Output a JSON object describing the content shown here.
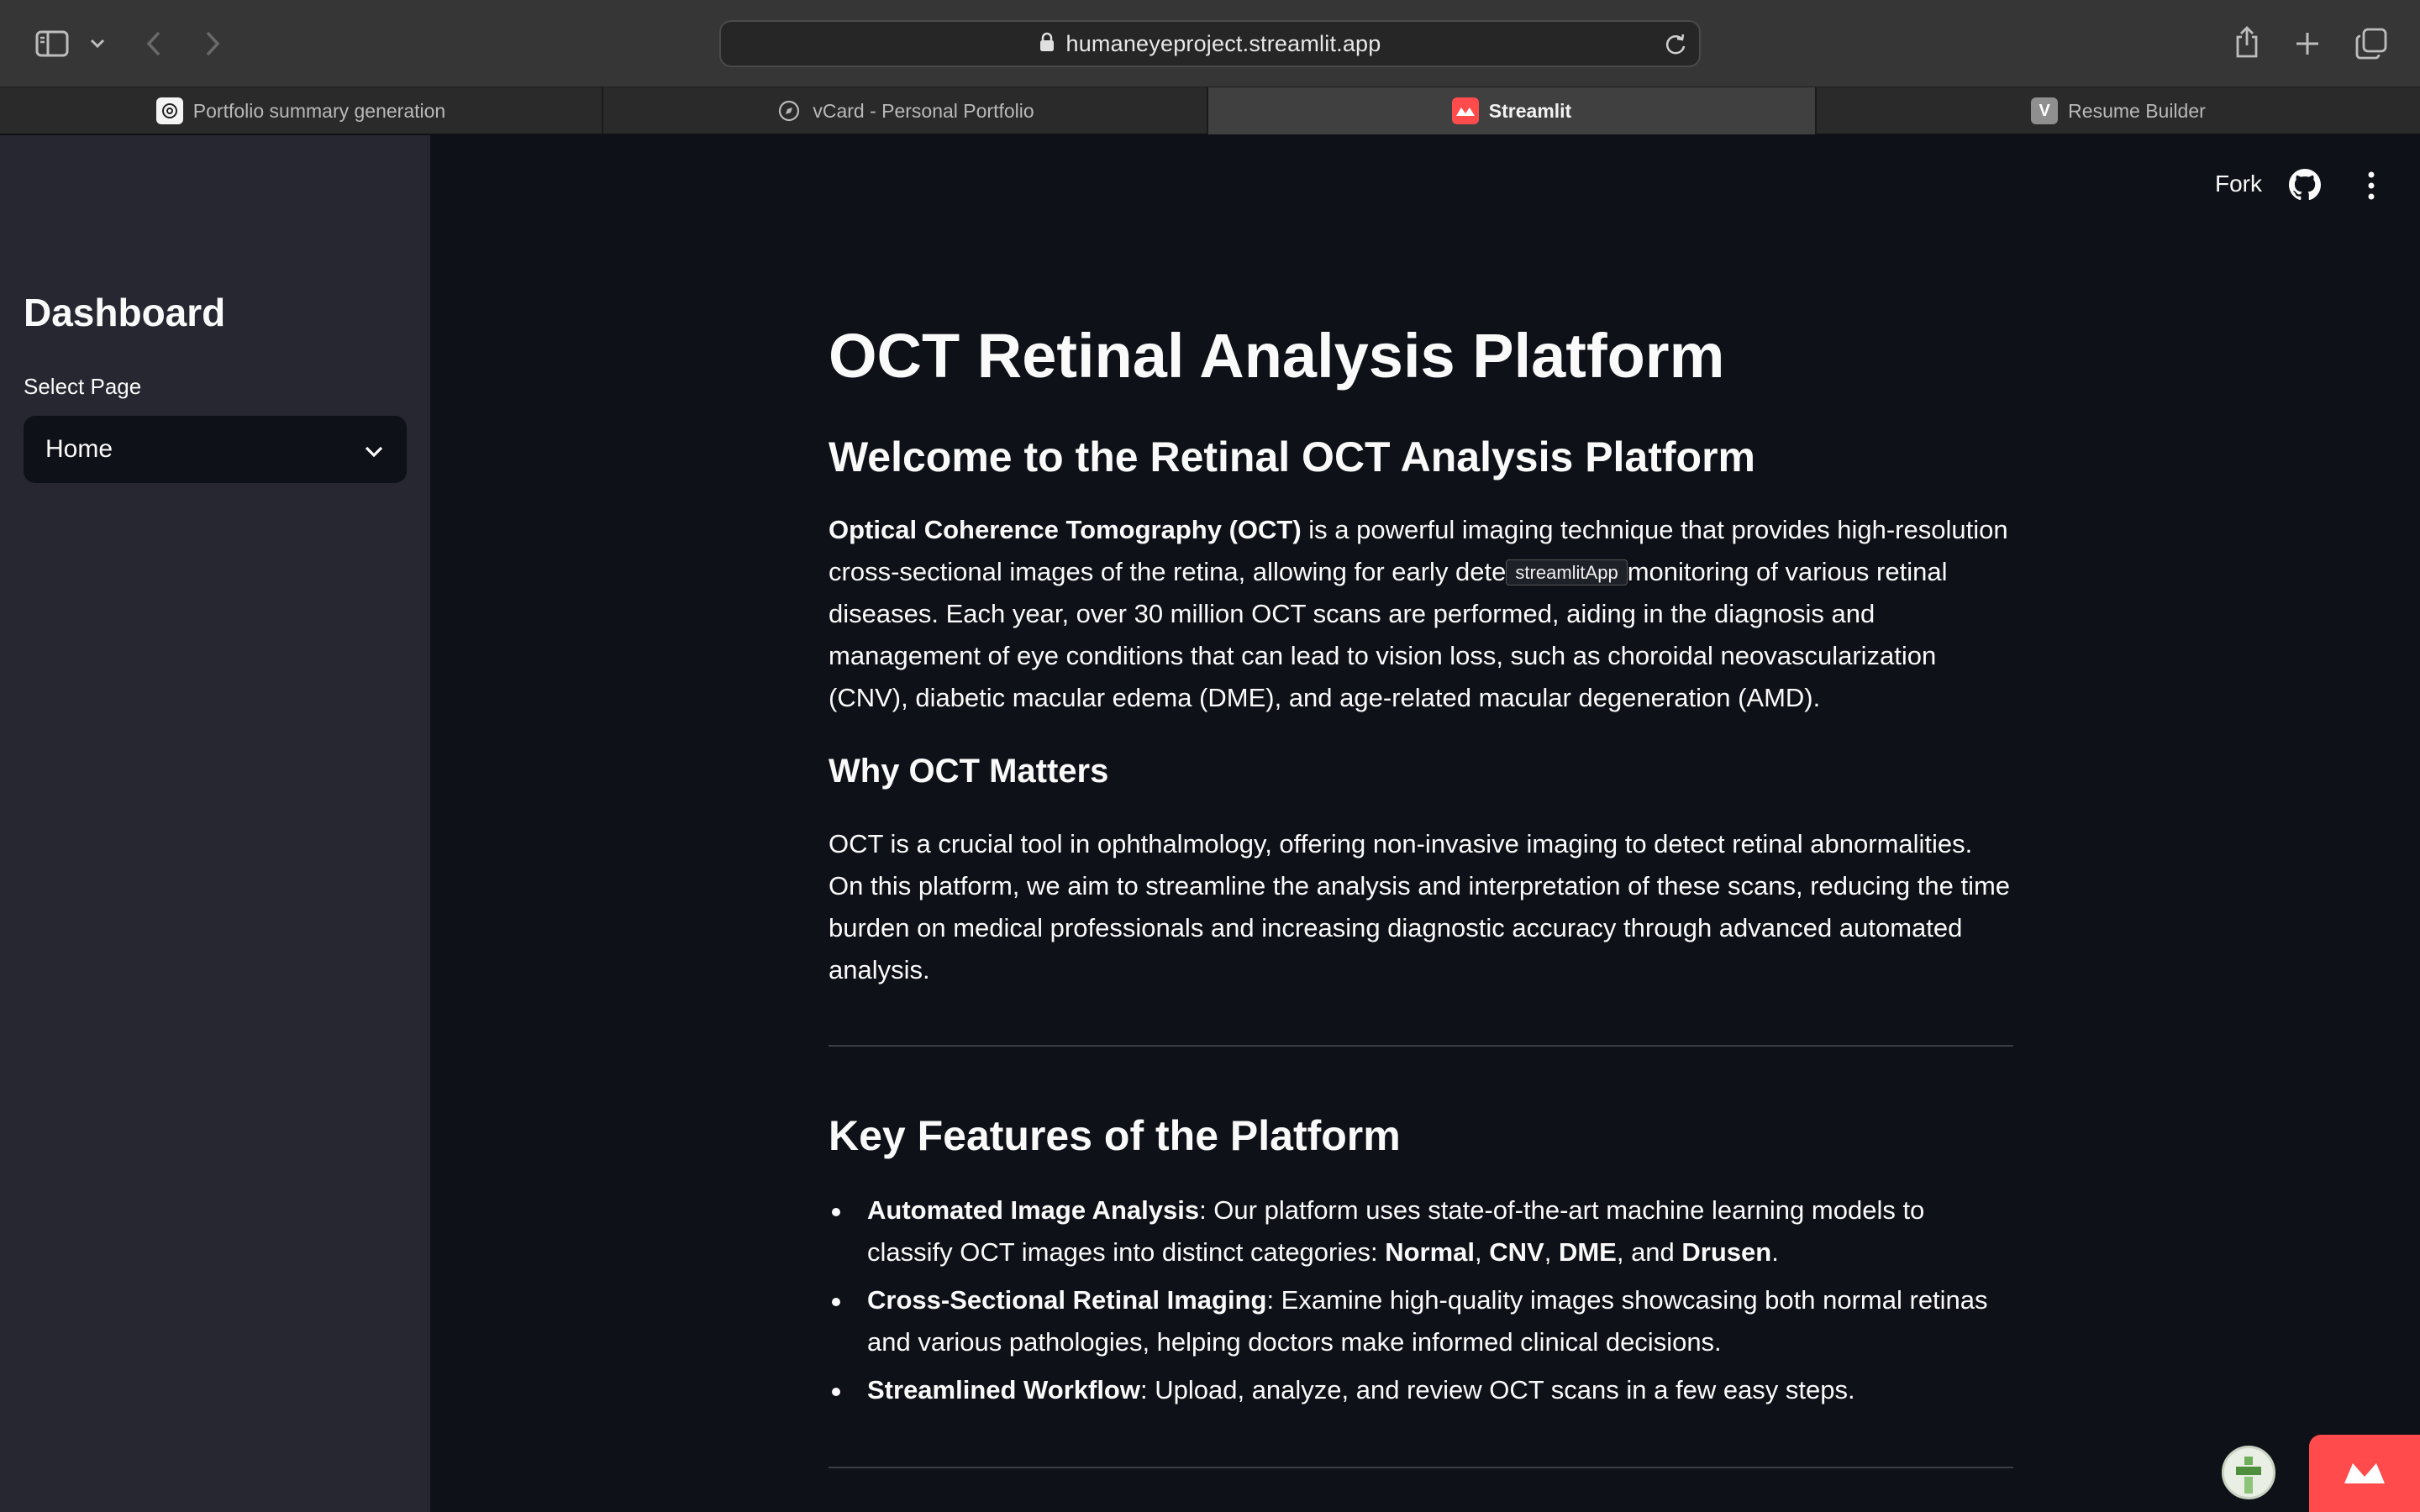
{
  "browser": {
    "url": "humaneyeproject.streamlit.app",
    "tabs": [
      {
        "label": "Portfolio summary generation",
        "icon": "openai-icon",
        "active": false
      },
      {
        "label": "vCard - Personal Portfolio",
        "icon": "compass-icon",
        "active": false
      },
      {
        "label": "Streamlit",
        "icon": "streamlit-icon",
        "active": true
      },
      {
        "label": "Resume Builder",
        "icon": "v-letter-icon",
        "active": false
      }
    ]
  },
  "sidebar": {
    "title": "Dashboard",
    "select_label": "Select Page",
    "select_value": "Home"
  },
  "header": {
    "fork_label": "Fork"
  },
  "main": {
    "title": "OCT Retinal Analysis Platform",
    "welcome_heading": "Welcome to the Retinal OCT Analysis Platform",
    "intro_bold": "Optical Coherence Tomography (OCT)",
    "intro_rest_1": " is a powerful imaging technique that provides high-resolution cross-sectional images of the retina, allowing for early dete",
    "tooltip": "streamlitApp",
    "intro_rest_2": "monitoring of various retinal diseases. Each year, over 30 million OCT scans are performed, aiding in the diagnosis and management of eye conditions that can lead to vision loss, such as choroidal neovascularization (CNV), diabetic macular edema (DME), and age-related macular degeneration (AMD).",
    "why_heading": "Why OCT Matters",
    "why_text": "OCT is a crucial tool in ophthalmology, offering non-invasive imaging to detect retinal abnormalities. On this platform, we aim to streamline the analysis and interpretation of these scans, reducing the time burden on medical professionals and increasing diagnostic accuracy through advanced automated analysis.",
    "features_heading": "Key Features of the Platform",
    "features": [
      {
        "title": "Automated Image Analysis",
        "text_before": ": Our platform uses state-of-the-art machine learning models to classify OCT images into distinct categories: ",
        "cat1": "Normal",
        "sep1": ", ",
        "cat2": "CNV",
        "sep2": ", ",
        "cat3": "DME",
        "sep3": ", and ",
        "cat4": "Drusen",
        "end": "."
      },
      {
        "title": "Cross-Sectional Retinal Imaging",
        "text": ": Examine high-quality images showcasing both normal retinas and various pathologies, helping doctors make informed clinical decisions."
      },
      {
        "title": "Streamlined Workflow",
        "text": ": Upload, analyze, and review OCT scans in a few easy steps."
      }
    ]
  },
  "colors": {
    "streamlit_red": "#ff4b4b",
    "app_bg": "#0e1117",
    "sidebar_bg": "#262730"
  }
}
